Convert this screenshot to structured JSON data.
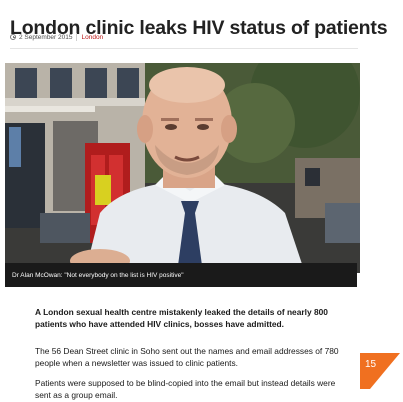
{
  "article": {
    "headline": "London clinic leaks HIV status of patients",
    "date": "2 September 2015",
    "section": "London",
    "video_caption": "Dr Alan McOwan: \"Not everybody on the list is HIV positive\"",
    "lead": "A London sexual health centre mistakenly leaked the details of nearly 800 patients who have attended HIV clinics, bosses have admitted.",
    "paragraphs": [
      "The 56 Dean Street clinic in Soho sent out the names and email addresses of 780 people when a newsletter was issued to clinic patients.",
      "Patients were supposed to be blind-copied into the email but instead details were sent as a group email."
    ]
  },
  "page_number": "15",
  "icons": {
    "timestamp": "clock-icon",
    "play": "play-icon"
  },
  "colors": {
    "accent": "#bb1919",
    "page_badge": "#f07020",
    "caption_bg": "#1a1a1a"
  }
}
